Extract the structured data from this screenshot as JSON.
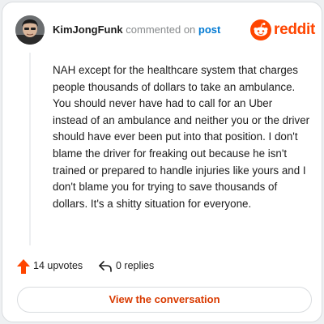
{
  "header": {
    "username": "KimJongFunk",
    "verb": "commented on",
    "link": "post",
    "brand": "reddit"
  },
  "comment": {
    "text": "NAH except for the healthcare system that charges people thousands of dollars to take an ambulance. You should never have had to call for an Uber instead of an ambulance and neither you or the driver should have ever been put into that position. I don't blame the driver for freaking out because he isn't trained or prepared to handle injuries like yours and I don't blame you for trying to save thousands of dollars. It's a shitty situation for everyone."
  },
  "actions": {
    "upvotes": "14 upvotes",
    "replies": "0 replies",
    "upvote_icon": "upvote-arrow-icon",
    "reply_icon": "reply-arrow-icon"
  },
  "button": {
    "label": "View the conversation"
  },
  "colors": {
    "brand": "#ff4500",
    "link": "#0079d3",
    "button_text": "#d93a00",
    "text": "#1c1c1c",
    "muted": "#878a8c"
  }
}
